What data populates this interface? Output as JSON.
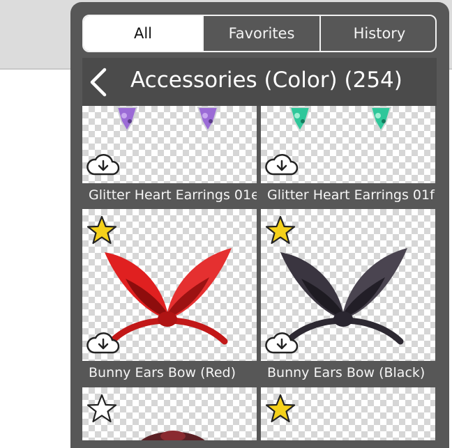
{
  "tabs": [
    {
      "label": "All",
      "active": true
    },
    {
      "label": "Favorites",
      "active": false
    },
    {
      "label": "History",
      "active": false
    }
  ],
  "header": {
    "title": "Accessories (Color) (254)"
  },
  "items": [
    {
      "name": "Glitter Heart Earrings 01e",
      "favorite": null,
      "gem_color": "#9b6bd6"
    },
    {
      "name": "Glitter Heart Earrings 01f",
      "favorite": null,
      "gem_color": "#2ec79a"
    },
    {
      "name": "Bunny Ears Bow (Red)",
      "favorite": true,
      "bow_color": "#e02020"
    },
    {
      "name": "Bunny Ears Bow (Black)",
      "favorite": true,
      "bow_color": "#3a3540"
    },
    {
      "name": "",
      "favorite": false
    },
    {
      "name": "",
      "favorite": true
    }
  ],
  "colors": {
    "panel": "#575757",
    "header": "#4b4b4b",
    "star": "#f5d11a"
  },
  "icons": [
    "back-icon",
    "cloud-download-icon",
    "star-icon"
  ]
}
